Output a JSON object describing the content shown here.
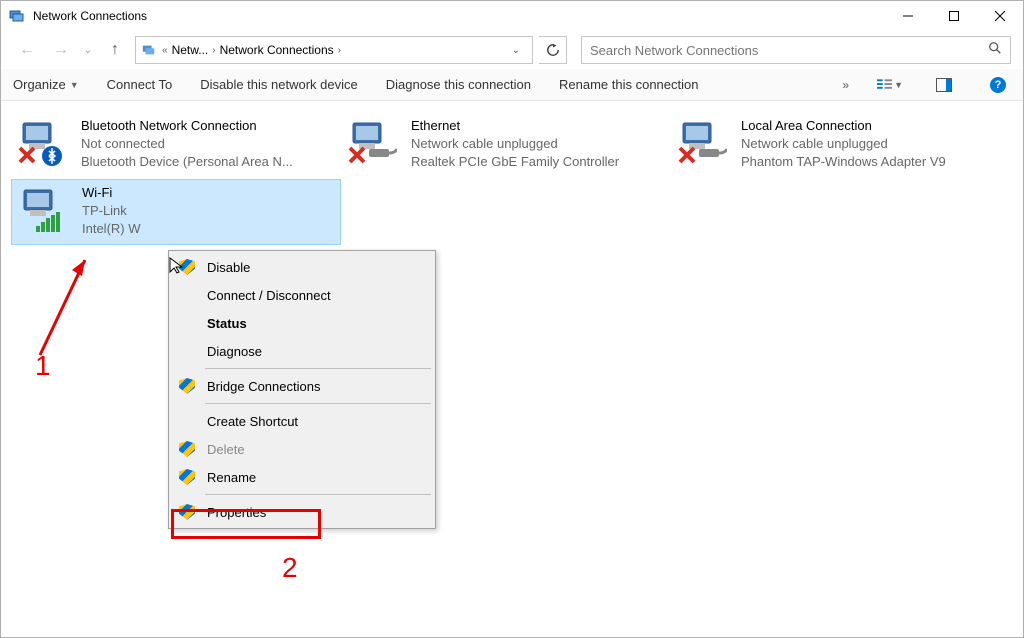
{
  "window": {
    "title": "Network Connections"
  },
  "breadcrumb": {
    "seg1": "Netw...",
    "seg2": "Network Connections"
  },
  "search": {
    "placeholder": "Search Network Connections"
  },
  "toolbar": {
    "organize": "Organize",
    "connect_to": "Connect To",
    "disable": "Disable this network device",
    "diagnose": "Diagnose this connection",
    "rename": "Rename this connection"
  },
  "connections": {
    "bluetooth": {
      "name": "Bluetooth Network Connection",
      "status": "Not connected",
      "device": "Bluetooth Device (Personal Area N..."
    },
    "ethernet": {
      "name": "Ethernet",
      "status": "Network cable unplugged",
      "device": "Realtek PCIe GbE Family Controller"
    },
    "lan": {
      "name": "Local Area Connection",
      "status": "Network cable unplugged",
      "device": "Phantom TAP-Windows Adapter V9"
    },
    "wifi": {
      "name": "Wi-Fi",
      "status": "TP-Link",
      "device": "Intel(R) W"
    }
  },
  "ctx": {
    "disable": "Disable",
    "connect_disconnect": "Connect / Disconnect",
    "status": "Status",
    "diagnose": "Diagnose",
    "bridge": "Bridge Connections",
    "create_shortcut": "Create Shortcut",
    "delete": "Delete",
    "rename": "Rename",
    "properties": "Properties"
  },
  "annotations": {
    "one": "1",
    "two": "2"
  }
}
